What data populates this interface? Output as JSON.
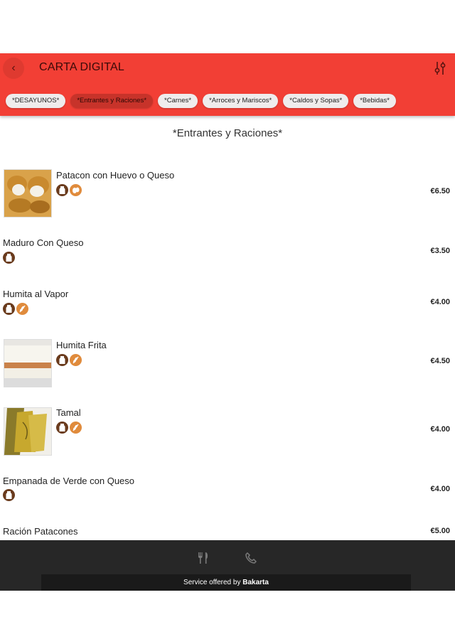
{
  "header": {
    "title": "CARTA DIGITAL",
    "back_icon": "chevron-left-icon",
    "filter_icon": "sliders-icon",
    "color": "#f23f35"
  },
  "categories": [
    {
      "label": "*DESAYUNOS*",
      "active": false
    },
    {
      "label": "*Entrantes y Raciones*",
      "active": true
    },
    {
      "label": "*Carnes*",
      "active": false
    },
    {
      "label": "*Arroces y Mariscos*",
      "active": false
    },
    {
      "label": "*Caldos y Sopas*",
      "active": false
    },
    {
      "label": "*Bebidas*",
      "active": false
    }
  ],
  "section": {
    "title": "*Entrantes y Raciones*"
  },
  "items": [
    {
      "name": "Patacon con Huevo o Queso",
      "price": "€6.50",
      "icons": [
        "milk-allergen-icon",
        "egg-allergen-icon"
      ]
    },
    {
      "name": "Maduro Con Queso",
      "price": "€3.50",
      "icons": [
        "milk-allergen-icon"
      ]
    },
    {
      "name": "Humita al Vapor",
      "price": "€4.00",
      "icons": [
        "milk-allergen-icon",
        "gluten-allergen-icon"
      ]
    },
    {
      "name": "Humita Frita",
      "price": "€4.50",
      "icons": [
        "milk-allergen-icon",
        "gluten-allergen-icon"
      ]
    },
    {
      "name": "Tamal",
      "price": "€4.00",
      "icons": [
        "milk-allergen-icon",
        "gluten-allergen-icon"
      ]
    },
    {
      "name": "Empanada de Verde con Queso",
      "price": "€4.00",
      "icons": [
        "milk-allergen-icon"
      ]
    },
    {
      "name": "Ración Patacones",
      "price": "€5.00",
      "icons": []
    }
  ],
  "footer": {
    "menu_icon": "fork-knife-icon",
    "phone_icon": "phone-icon",
    "service_prefix": "Service offered by ",
    "service_brand": "Bakarta"
  }
}
